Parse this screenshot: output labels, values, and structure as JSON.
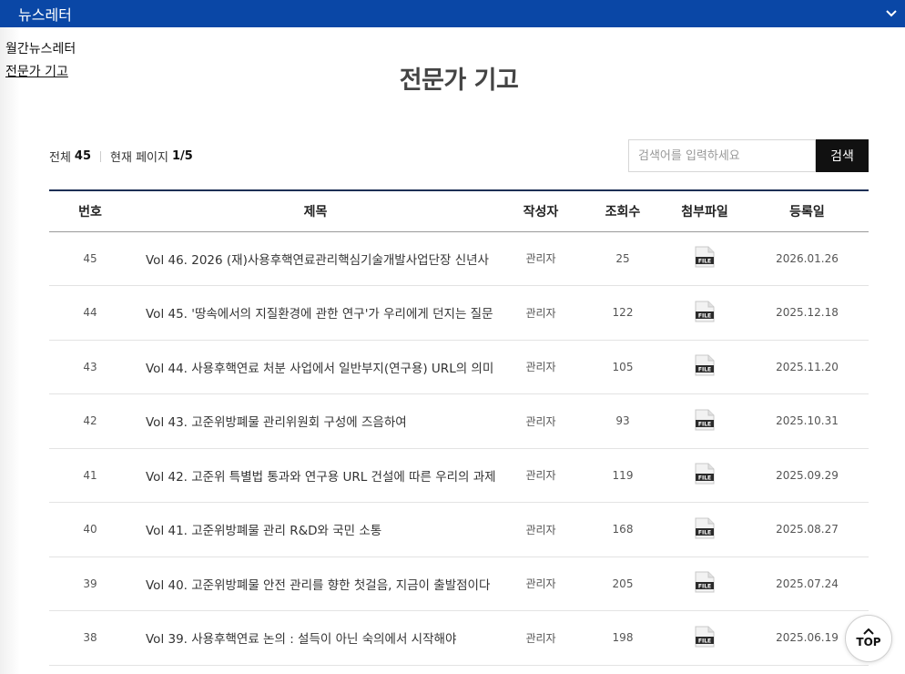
{
  "header": {
    "title": "뉴스레터"
  },
  "submenu": [
    {
      "label": "월간뉴스레터"
    },
    {
      "label": "전문가 기고"
    }
  ],
  "page_title": "전문가 기고",
  "board_info": {
    "total_label": "전체",
    "total_count": "45",
    "page_label": "현재 페이지",
    "page_value": "1/5"
  },
  "search": {
    "placeholder": "검색어를 입력하세요",
    "button_label": "검색"
  },
  "table": {
    "columns": [
      "번호",
      "제목",
      "작성자",
      "조회수",
      "첨부파일",
      "등록일"
    ],
    "file_icon_text": "FILE",
    "rows": [
      {
        "no": "45",
        "title": "Vol 46. 2026 (재)사용후핵연료관리핵심기술개발사업단장 신년사",
        "author": "관리자",
        "views": "25",
        "date": "2026.01.26"
      },
      {
        "no": "44",
        "title": "Vol 45. '땅속에서의 지질환경에 관한 연구'가 우리에게 던지는 질문",
        "author": "관리자",
        "views": "122",
        "date": "2025.12.18"
      },
      {
        "no": "43",
        "title": "Vol 44. 사용후핵연료 처분 사업에서 일반부지(연구용) URL의 의미",
        "author": "관리자",
        "views": "105",
        "date": "2025.11.20"
      },
      {
        "no": "42",
        "title": "Vol 43. 고준위방폐물 관리위원회 구성에 즈음하여",
        "author": "관리자",
        "views": "93",
        "date": "2025.10.31"
      },
      {
        "no": "41",
        "title": "Vol 42. 고준위 특별법 통과와 연구용 URL 건설에 따른 우리의 과제",
        "author": "관리자",
        "views": "119",
        "date": "2025.09.29"
      },
      {
        "no": "40",
        "title": "Vol 41. 고준위방폐물 관리 R&D와 국민 소통",
        "author": "관리자",
        "views": "168",
        "date": "2025.08.27"
      },
      {
        "no": "39",
        "title": "Vol 40. 고준위방폐물 안전 관리를 향한 첫걸음, 지금이 출발점이다",
        "author": "관리자",
        "views": "205",
        "date": "2025.07.24"
      },
      {
        "no": "38",
        "title": "Vol 39. 사용후핵연료 논의 : 설득이 아닌 숙의에서 시작해야",
        "author": "관리자",
        "views": "198",
        "date": "2025.06.19"
      }
    ]
  },
  "top_button": {
    "label": "TOP"
  },
  "colors": {
    "header_bg": "#0a47a6",
    "table_top_border": "#1d2f55",
    "search_button_bg": "#111111"
  }
}
